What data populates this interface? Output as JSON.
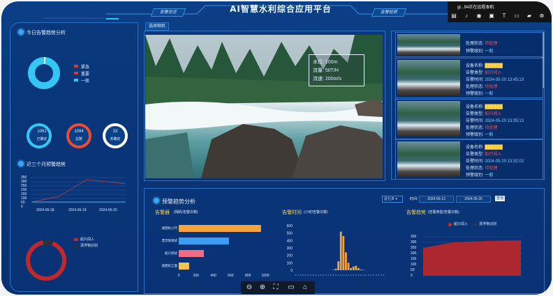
{
  "app_title": "AI智慧水利综合应用平台",
  "header": {
    "tab_left": "告警总览",
    "tab_right": "告警检索"
  },
  "left": {
    "today_title": "今日告警趋势分析",
    "legend": [
      {
        "label": "紧急",
        "color": "#e03a2f"
      },
      {
        "label": "重要",
        "color": "#d63a2a"
      },
      {
        "label": "一般",
        "color": "#36c3f0"
      }
    ],
    "circles": [
      {
        "value": "1061",
        "label": "已确定",
        "color": "#35c6f4"
      },
      {
        "value": "1094",
        "label": "总数",
        "color": "#ef4b33"
      },
      {
        "value": "33",
        "label": "未确定",
        "color": "#ffffff"
      }
    ],
    "three_month_title": "近三个月预警趋势",
    "y_ticks": [
      "350",
      "300",
      "250",
      "200",
      "150",
      "100",
      "50",
      "0"
    ],
    "x_ticks": [
      "2024-05-18",
      "2024-05-19",
      "2024-05-20"
    ],
    "pie_legend": [
      {
        "label": "船只闯入",
        "color": "#c1282b"
      },
      {
        "label": "漂浮物识别",
        "color": "#2f2f35"
      }
    ]
  },
  "video": {
    "tab": "选择相机",
    "overlay": {
      "level": "水位: 100m",
      "flow": "流量: 50T/H",
      "speed": "流速: 200m/s"
    }
  },
  "cameras": [
    {
      "lines": [
        {
          "k": "处理状态:",
          "v": "待处理",
          "c": "red"
        },
        {
          "k": "预警级别:",
          "v": "一般",
          "c": "blue"
        }
      ]
    },
    {
      "lines": [
        {
          "k": "设备名称:",
          "v": "██████",
          "c": "yellow"
        },
        {
          "k": "告警类型:",
          "v": "船只闯入",
          "c": "red"
        },
        {
          "k": "告警时间:",
          "v": "2024-05-20 13:45:13",
          "c": "blue"
        },
        {
          "k": "处理状态:",
          "v": "待处理",
          "c": "red"
        },
        {
          "k": "预警级别:",
          "v": "一般",
          "c": "blue"
        }
      ]
    },
    {
      "lines": [
        {
          "k": "设备名称:",
          "v": "██████",
          "c": "yellow"
        },
        {
          "k": "告警类型:",
          "v": "船只闯入",
          "c": "red"
        },
        {
          "k": "告警时间:",
          "v": "2024-05-20 13:35:13",
          "c": "blue"
        },
        {
          "k": "处理状态:",
          "v": "待处理",
          "c": "red"
        },
        {
          "k": "预警级别:",
          "v": "一般",
          "c": "blue"
        }
      ]
    },
    {
      "lines": [
        {
          "k": "设备名称:",
          "v": "██████",
          "c": "yellow"
        },
        {
          "k": "告警类型:",
          "v": "船只闯入",
          "c": "red"
        },
        {
          "k": "告警时间:",
          "v": "2024-05-20 13:32:02",
          "c": "blue"
        },
        {
          "k": "处理状态:",
          "v": "待处理",
          "c": "red"
        },
        {
          "k": "预警级别:",
          "v": "一般",
          "c": "blue"
        }
      ]
    }
  ],
  "bottom": {
    "title": "预警趋势分析",
    "range_select": "近七天",
    "time_label": "时间:",
    "date_from": "2024-05-13",
    "date_to": "2024-05-20",
    "query_btn": "查询",
    "device": {
      "title": "告警器",
      "subtitle": "(相机/告警次数)",
      "categories": [
        "城隍机小尺",
        "漂浮物测试",
        "船只测试",
        "城隍机江面"
      ],
      "values": [
        950,
        580,
        290,
        120
      ],
      "colors": [
        "#f5a33c",
        "#3c9df2",
        "#f06d86",
        "#f8c252"
      ],
      "x_ticks": [
        "0",
        "200",
        "400",
        "600",
        "800",
        "1000"
      ]
    },
    "time": {
      "title": "告警时间",
      "subtitle": "(小时/告警次数)",
      "y_ticks": [
        "600",
        "500",
        "400",
        "300",
        "200",
        "100",
        "0"
      ],
      "values": [
        0,
        0,
        0,
        0,
        0,
        0,
        0,
        0,
        0,
        0,
        0,
        0,
        0,
        0,
        0,
        5,
        20,
        120,
        520,
        460,
        240,
        100,
        30,
        50,
        60,
        30,
        10,
        5,
        0,
        0,
        0,
        0,
        0,
        0,
        0,
        0
      ]
    },
    "trend": {
      "title": "告警趋势",
      "subtitle": "(告警类型/告警次数)",
      "legend": [
        {
          "label": "船只闯入",
          "color": "#d32a2a"
        },
        {
          "label": "漂浮物识别",
          "color": "#2b3b4d"
        }
      ],
      "y_ticks": [
        "350",
        "300",
        "250",
        "200",
        "150",
        "100",
        "50",
        "0"
      ]
    }
  },
  "toolbar": {
    "icons": [
      "zoom-out-icon",
      "zoom-in-icon",
      "fullscreen-icon",
      "comment-icon",
      "share-icon"
    ]
  },
  "topbar": {
    "title": "gl...94正在远程本机"
  }
}
